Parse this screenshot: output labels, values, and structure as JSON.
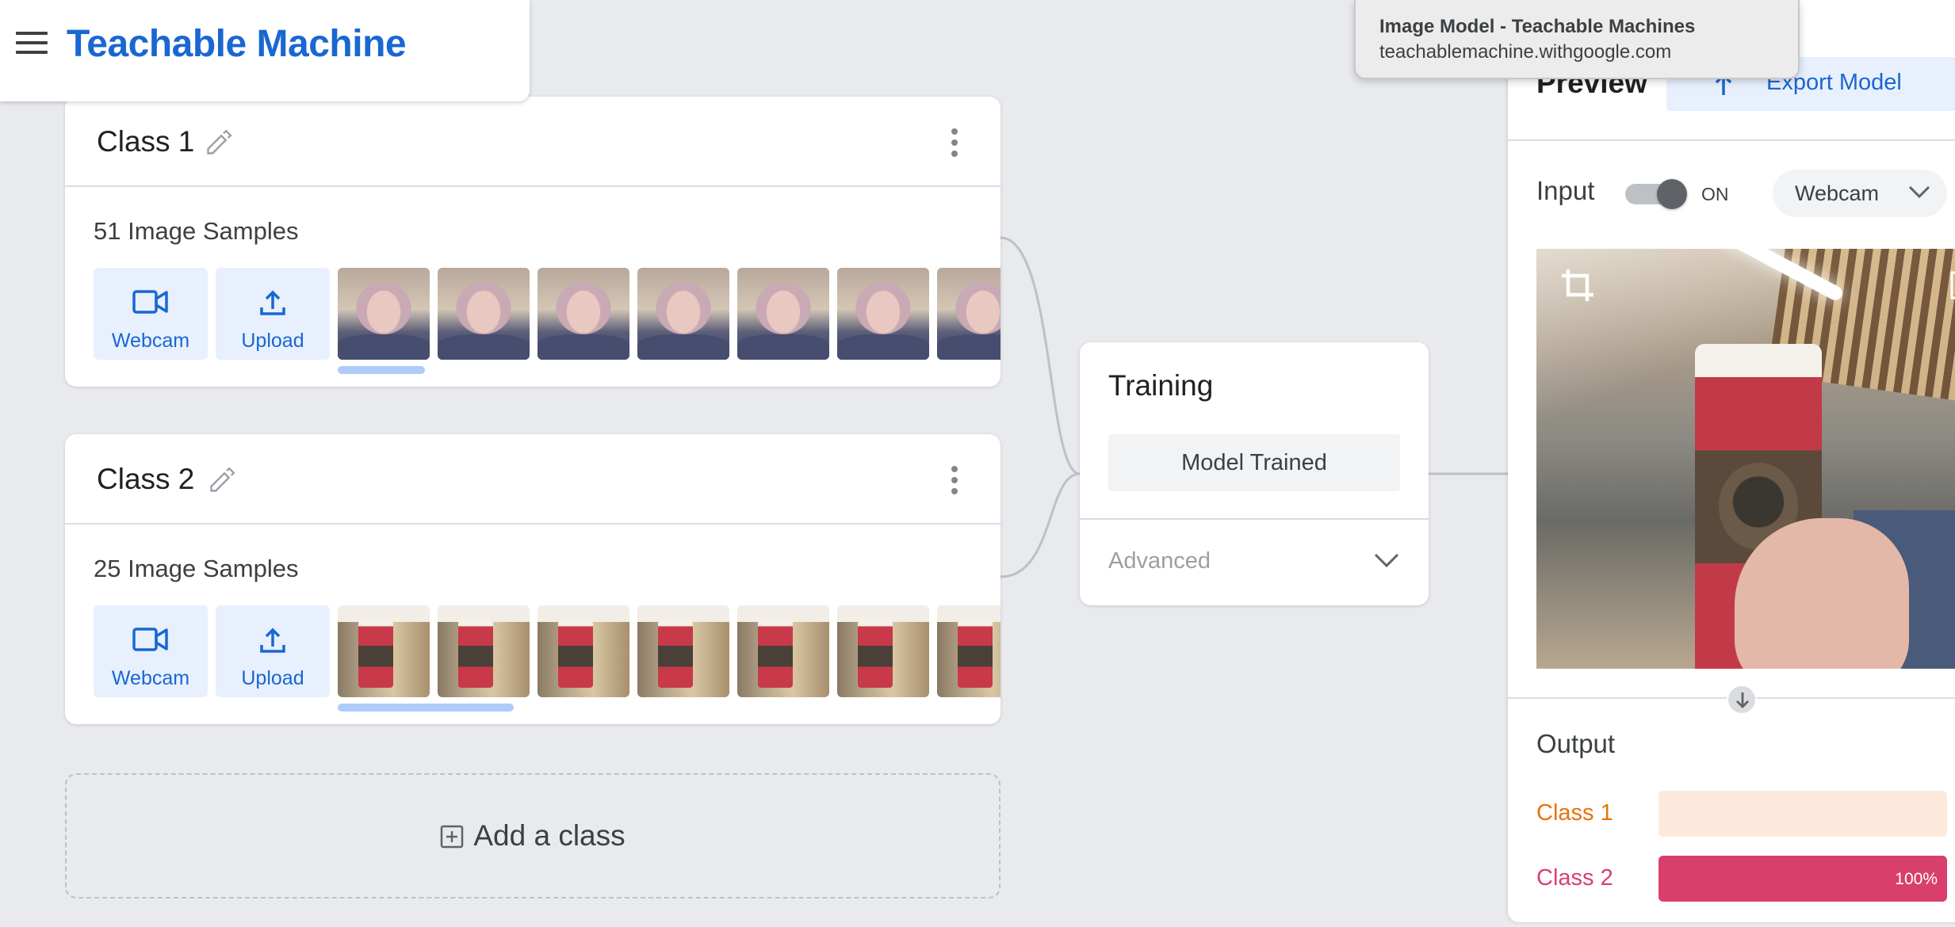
{
  "app": {
    "title": "Teachable Machine"
  },
  "tooltip": {
    "title": "Image Model - Teachable Machines",
    "url": "teachablemachine.withgoogle.com"
  },
  "classes": [
    {
      "name": "Class 1",
      "samples_label": "51 Image Samples",
      "thumb_kind": "face",
      "webcam_label": "Webcam",
      "upload_label": "Upload"
    },
    {
      "name": "Class 2",
      "samples_label": "25 Image Samples",
      "thumb_kind": "cup",
      "webcam_label": "Webcam",
      "upload_label": "Upload"
    }
  ],
  "add_class": {
    "label": "Add a class"
  },
  "training": {
    "title": "Training",
    "button_label": "Model Trained",
    "advanced_label": "Advanced"
  },
  "preview": {
    "title": "Preview",
    "export_label": "Export Model",
    "input_label": "Input",
    "toggle_state": "ON",
    "source_select": "Webcam",
    "output_label": "Output",
    "outputs": [
      {
        "label": "Class 1",
        "confidence": 0,
        "percent_label": "",
        "color": "#e8710a",
        "bg": "#fde9dc"
      },
      {
        "label": "Class 2",
        "confidence": 1.0,
        "percent_label": "100%",
        "color": "#d93f6b",
        "bg": "#fce4ec"
      }
    ]
  },
  "colors": {
    "brand": "#1967d2",
    "background": "#e8eaed"
  }
}
